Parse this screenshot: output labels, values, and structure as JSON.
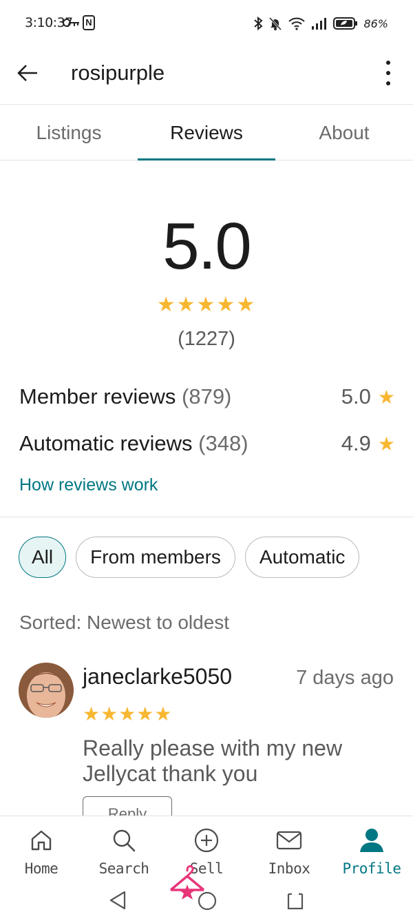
{
  "status_bar": {
    "time": "3:10:37",
    "battery": "86%",
    "nfc": "N"
  },
  "header": {
    "title": "rosipurple"
  },
  "tabs": [
    {
      "label": "Listings",
      "active": false
    },
    {
      "label": "Reviews",
      "active": true
    },
    {
      "label": "About",
      "active": false
    }
  ],
  "summary": {
    "rating": "5.0",
    "stars": "★★★★★",
    "count": "(1227)",
    "member_label": "Member reviews",
    "member_count": "(879)",
    "member_score": "5.0",
    "auto_label": "Automatic reviews",
    "auto_count": "(348)",
    "auto_score": "4.9",
    "star_glyph": "★",
    "how_link": "How reviews work"
  },
  "filters": {
    "all": "All",
    "members": "From members",
    "automatic": "Automatic",
    "selected": "All"
  },
  "sort_label": "Sorted: Newest to oldest",
  "reviews": [
    {
      "username": "janeclarke5050",
      "time": "7 days ago",
      "stars": "★★★★★",
      "text": "Really please with my new Jellycat thank you",
      "reply_label": "Reply"
    }
  ],
  "bottom_nav": [
    {
      "label": "Home",
      "icon": "home-icon",
      "active": false
    },
    {
      "label": "Search",
      "icon": "search-icon",
      "active": false
    },
    {
      "label": "Sell",
      "icon": "plus-circle-icon",
      "active": false
    },
    {
      "label": "Inbox",
      "icon": "mail-icon",
      "active": false
    },
    {
      "label": "Profile",
      "icon": "person-icon",
      "active": true
    }
  ],
  "colors": {
    "accent": "#007782",
    "star": "#f7b731",
    "hanger": "#e8357a"
  }
}
